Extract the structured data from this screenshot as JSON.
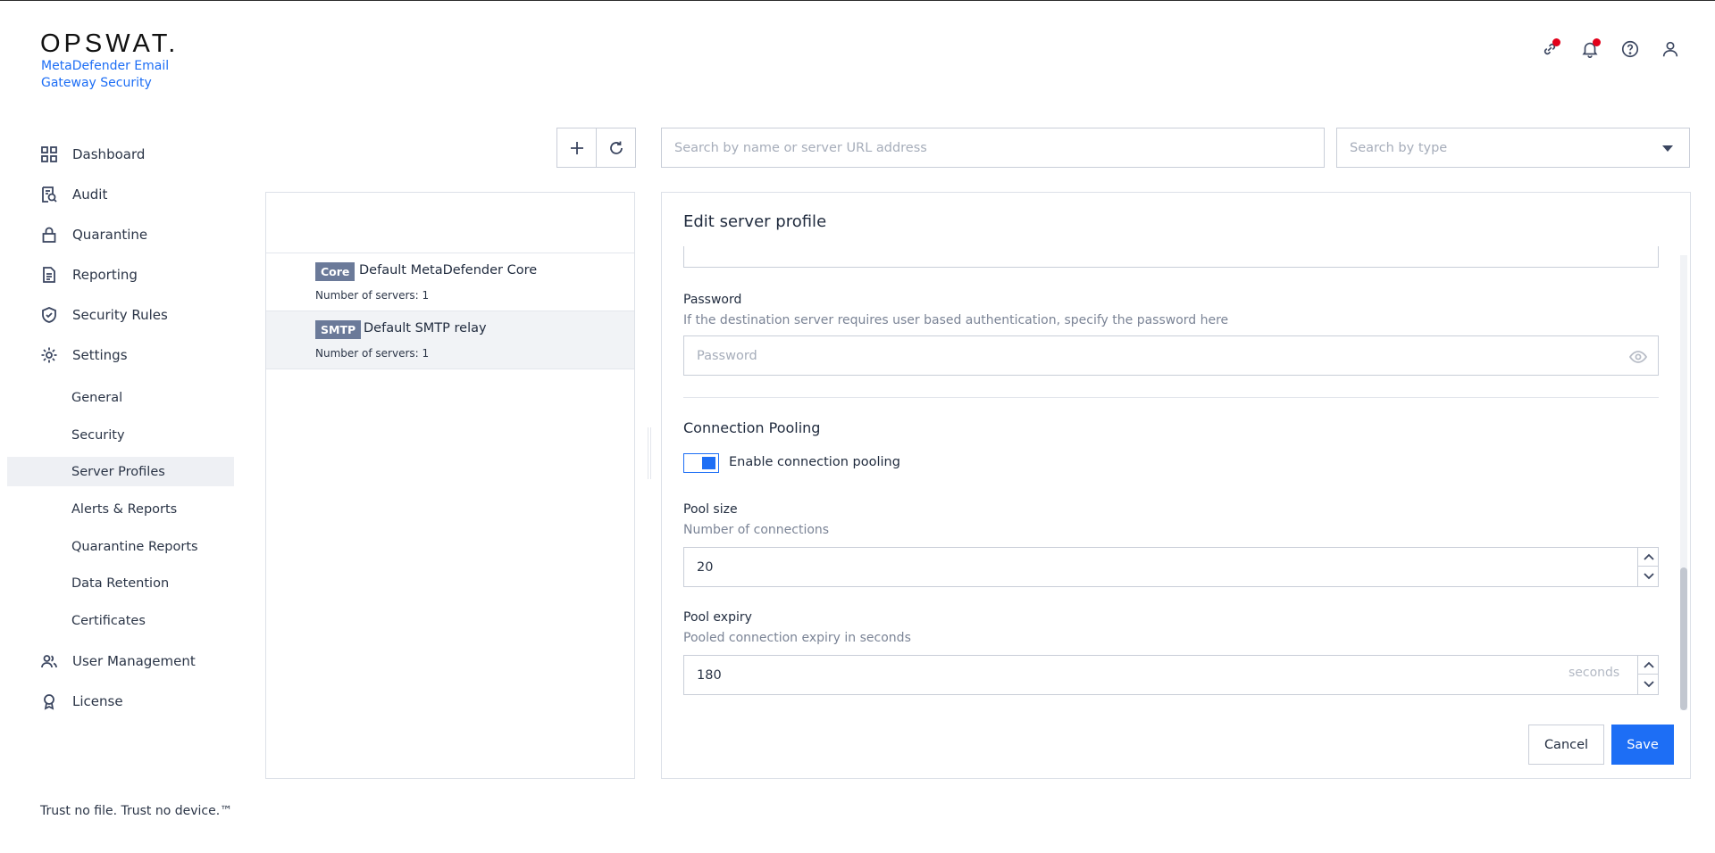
{
  "brand": {
    "logo": "OPSWAT.",
    "product": "MetaDefender Email Gateway Security",
    "tagline": "Trust no file. Trust no device.™"
  },
  "header_icons": [
    "link-icon",
    "bell-icon",
    "help-icon",
    "user-icon"
  ],
  "sidebar": {
    "items": [
      {
        "label": "Dashboard",
        "icon": "dashboard-icon"
      },
      {
        "label": "Audit",
        "icon": "audit-icon"
      },
      {
        "label": "Quarantine",
        "icon": "lock-icon"
      },
      {
        "label": "Reporting",
        "icon": "document-icon"
      },
      {
        "label": "Security Rules",
        "icon": "shield-check-icon"
      },
      {
        "label": "Settings",
        "icon": "gear-icon"
      }
    ],
    "settings_sub": [
      {
        "label": "General"
      },
      {
        "label": "Security"
      },
      {
        "label": "Server Profiles",
        "active": true
      },
      {
        "label": "Alerts & Reports"
      },
      {
        "label": "Quarantine Reports"
      },
      {
        "label": "Data Retention"
      },
      {
        "label": "Certificates"
      }
    ],
    "bottom_items": [
      {
        "label": "User Management",
        "icon": "users-icon"
      },
      {
        "label": "License",
        "icon": "badge-icon"
      }
    ]
  },
  "toolbar": {
    "search_placeholder": "Search by name or server URL address",
    "type_placeholder": "Search by type"
  },
  "profiles": [
    {
      "badge": "Core",
      "name": "Default MetaDefender Core",
      "servers": "Number of servers: 1"
    },
    {
      "badge": "SMTP",
      "name": "Default SMTP relay",
      "servers": "Number of servers: 1",
      "active": true
    }
  ],
  "edit": {
    "title": "Edit server profile",
    "password": {
      "label": "Password",
      "description": "If the destination server requires user based authentication, specify the password here",
      "placeholder": "Password",
      "value": ""
    },
    "pooling": {
      "heading": "Connection Pooling",
      "toggle_label": "Enable connection pooling",
      "enabled": true
    },
    "pool_size": {
      "label": "Pool size",
      "description": "Number of connections",
      "value": "20"
    },
    "pool_expiry": {
      "label": "Pool expiry",
      "description": "Pooled connection expiry in seconds",
      "value": "180",
      "unit": "seconds"
    },
    "cancel_label": "Cancel",
    "save_label": "Save"
  }
}
